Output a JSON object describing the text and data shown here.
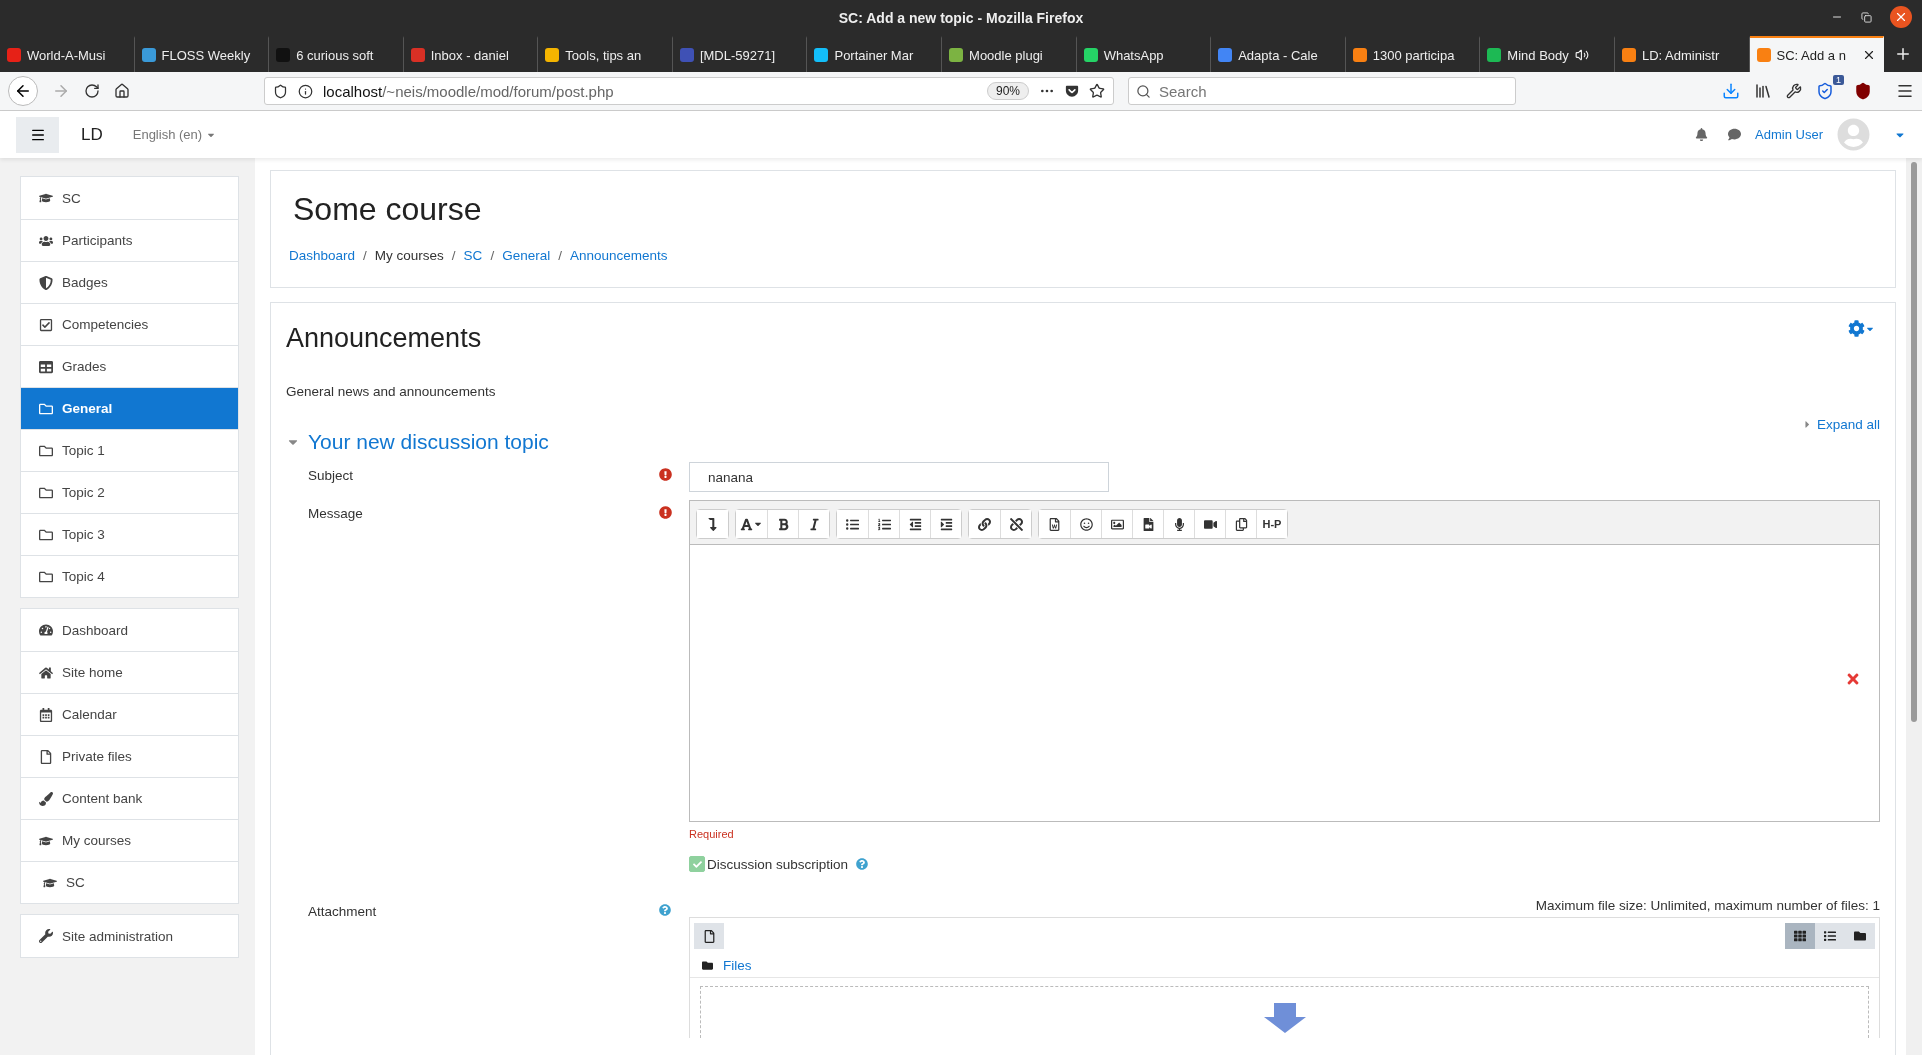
{
  "window": {
    "title": "SC: Add a new topic - Mozilla Firefox"
  },
  "tabs": [
    {
      "label": "World-A-Musi",
      "color": "#e62117",
      "audio": false,
      "selected": false
    },
    {
      "label": "FLOSS Weekly",
      "color": "#3a9ad9",
      "audio": false,
      "selected": false
    },
    {
      "label": "6 curious soft",
      "color": "#111111",
      "audio": false,
      "selected": false
    },
    {
      "label": "Inbox - daniel",
      "color": "#d93025",
      "audio": false,
      "selected": false
    },
    {
      "label": "Tools, tips an",
      "color": "#f4b400",
      "audio": false,
      "selected": false
    },
    {
      "label": "[MDL-59271]",
      "color": "#3f51b5",
      "audio": false,
      "selected": false
    },
    {
      "label": "Portainer Mar",
      "color": "#13bef9",
      "audio": false,
      "selected": false
    },
    {
      "label": "Moodle plugi",
      "color": "#7cb342",
      "audio": false,
      "selected": false
    },
    {
      "label": "WhatsApp",
      "color": "#25d366",
      "audio": false,
      "selected": false
    },
    {
      "label": "Adapta - Cale",
      "color": "#4285f4",
      "audio": false,
      "selected": false
    },
    {
      "label": "1300 participa",
      "color": "#f98012",
      "audio": false,
      "selected": false
    },
    {
      "label": "Mind Body",
      "color": "#1db954",
      "audio": true,
      "selected": false
    },
    {
      "label": "LD: Administr",
      "color": "#f98012",
      "audio": false,
      "selected": false
    },
    {
      "label": "SC: Add a n",
      "color": "#f98012",
      "audio": false,
      "selected": true
    }
  ],
  "address_bar": {
    "host": "localhost",
    "path": "/~neis/moodle/mod/forum/post.php",
    "zoom": "90%"
  },
  "search": {
    "placeholder": "Search"
  },
  "extension_badge": "1",
  "moodle_nav": {
    "site": "LD",
    "language": "English (en)",
    "user": "Admin User"
  },
  "sidebar": {
    "groups": [
      [
        {
          "label": "SC",
          "kind": "course",
          "selected": false
        },
        {
          "label": "Participants",
          "kind": "users",
          "selected": false
        },
        {
          "label": "Badges",
          "kind": "shield",
          "selected": false
        },
        {
          "label": "Competencies",
          "kind": "check",
          "selected": false
        },
        {
          "label": "Grades",
          "kind": "table",
          "selected": false
        },
        {
          "label": "General",
          "kind": "folder",
          "selected": true
        },
        {
          "label": "Topic 1",
          "kind": "folder",
          "selected": false
        },
        {
          "label": "Topic 2",
          "kind": "folder",
          "selected": false
        },
        {
          "label": "Topic 3",
          "kind": "folder",
          "selected": false
        },
        {
          "label": "Topic 4",
          "kind": "folder",
          "selected": false
        }
      ],
      [
        {
          "label": "Dashboard",
          "kind": "gauge",
          "selected": false
        },
        {
          "label": "Site home",
          "kind": "home",
          "selected": false
        },
        {
          "label": "Calendar",
          "kind": "calendar",
          "selected": false
        },
        {
          "label": "Private files",
          "kind": "file",
          "selected": false
        },
        {
          "label": "Content bank",
          "kind": "brush",
          "selected": false
        },
        {
          "label": "My courses",
          "kind": "course",
          "selected": false,
          "children": [
            {
              "label": "SC",
              "kind": "course",
              "selected": false
            }
          ]
        }
      ],
      [
        {
          "label": "Site administration",
          "kind": "wrench",
          "selected": false
        }
      ]
    ]
  },
  "course": {
    "title": "Some course",
    "separator": "/",
    "breadcrumbs": [
      {
        "label": "Dashboard",
        "link": true
      },
      {
        "label": "My courses",
        "link": false
      },
      {
        "label": "SC",
        "link": true
      },
      {
        "label": "General",
        "link": true
      },
      {
        "label": "Announcements",
        "link": true
      }
    ]
  },
  "forum": {
    "title": "Announcements",
    "description": "General news and announcements",
    "expand_all": "Expand all",
    "section": {
      "title": "Your new discussion topic",
      "expanded": true
    },
    "subject": {
      "label": "Subject",
      "required": true,
      "value": "nanana"
    },
    "message": {
      "label": "Message",
      "required": true,
      "error": "Required",
      "toolbar": [
        [
          {
            "kind": "collapse"
          }
        ],
        [
          {
            "kind": "font"
          },
          {
            "kind": "bold"
          },
          {
            "kind": "italic"
          }
        ],
        [
          {
            "kind": "bullets"
          },
          {
            "kind": "numbers"
          },
          {
            "kind": "outdent"
          },
          {
            "kind": "indent"
          }
        ],
        [
          {
            "kind": "link"
          },
          {
            "kind": "unlink"
          }
        ],
        [
          {
            "kind": "word"
          },
          {
            "kind": "emoji"
          },
          {
            "kind": "image"
          },
          {
            "kind": "media"
          },
          {
            "kind": "audio"
          },
          {
            "kind": "video"
          },
          {
            "kind": "copy"
          },
          {
            "kind": "h5p",
            "label": "H-P"
          }
        ]
      ]
    },
    "subscription": {
      "label": "Discussion subscription",
      "checked": true
    },
    "attachment": {
      "label": "Attachment",
      "info": "Maximum file size: Unlimited, maximum number of files: 1",
      "folder": "Files",
      "views": [
        {
          "kind": "grid",
          "selected": true
        },
        {
          "kind": "list",
          "selected": false
        },
        {
          "kind": "tree",
          "selected": false
        }
      ]
    }
  }
}
